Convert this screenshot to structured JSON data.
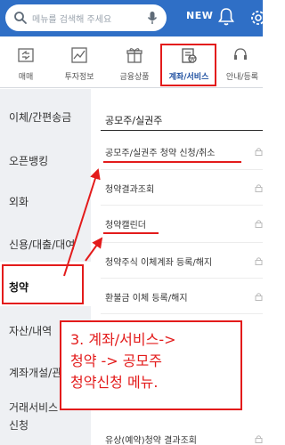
{
  "header": {
    "search_placeholder": "메뉴를 검색해 주세요",
    "new_badge": "NEW"
  },
  "tabs": [
    {
      "label": "매매",
      "icon": "trade-icon"
    },
    {
      "label": "투자정보",
      "icon": "chart-icon"
    },
    {
      "label": "금융상품",
      "icon": "gift-icon"
    },
    {
      "label": "계좌/서비스",
      "icon": "account-service-icon",
      "active": true
    },
    {
      "label": "안내/등록",
      "icon": "support-icon"
    }
  ],
  "leftnav": {
    "items": [
      {
        "label": "이체/간편송금"
      },
      {
        "label": "오픈뱅킹"
      },
      {
        "label": "외화"
      },
      {
        "label": "신용/대출/대여"
      },
      {
        "label": "청약",
        "active": true
      },
      {
        "label": "자산/내역"
      },
      {
        "label": "계좌개설/관리"
      },
      {
        "label": "거래서비스"
      },
      {
        "label": "신청"
      }
    ]
  },
  "content": {
    "section_title": "공모주/실권주",
    "items": [
      {
        "label": "공모주/실권주 청약 신청/취소"
      },
      {
        "label": "청약결과조회"
      },
      {
        "label": "청약캘린더"
      },
      {
        "label": "청약주식 이체계좌 등록/해지"
      },
      {
        "label": "환불금 이체 등록/해지"
      },
      {
        "label": "유상(예약)청약 결과조회"
      }
    ]
  },
  "annotation": {
    "line1": "3. 계좌/서비스->",
    "line2": "청약 -> 공모주",
    "line3": "청약신청 메뉴."
  },
  "colors": {
    "header_blue": "#2f6fc6",
    "highlight_red": "#e31b1b",
    "active_tab_blue": "#1e4fa0"
  }
}
